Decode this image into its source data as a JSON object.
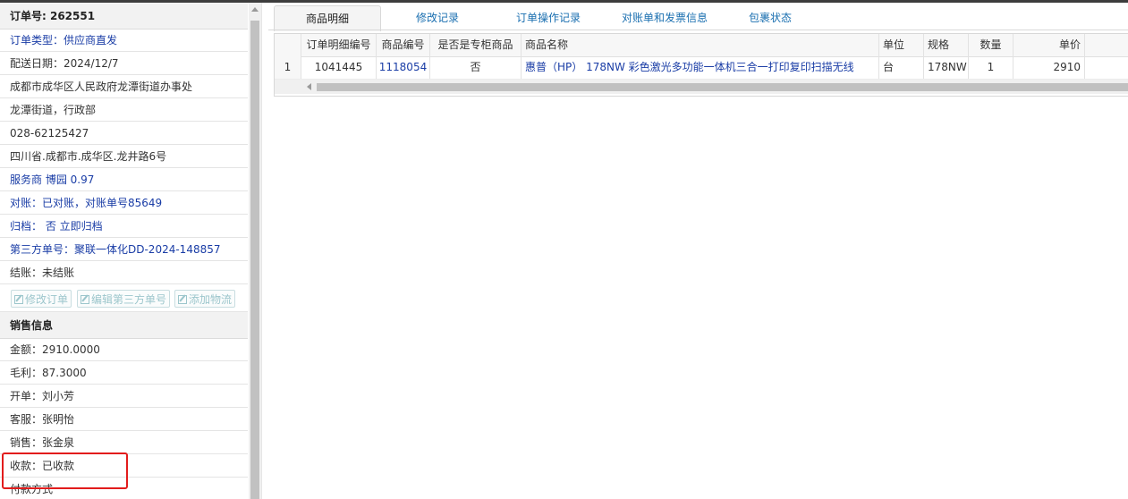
{
  "order": {
    "number_label": "订单号: 262551",
    "rows": [
      "订单类型：供应商直发",
      "配送日期：2024/12/7",
      "成都市成华区人民政府龙潭街道办事处",
      "龙潭街道，行政部",
      "028-62125427",
      "四川省.成都市.成华区.龙井路6号",
      "服务商 博园 0.97",
      "对账：已对账，对账单号85649",
      "归档： 否 立即归档",
      "第三方单号：聚联一体化DD-2024-148857",
      "结账：未结账"
    ],
    "buttons": [
      "修改订单",
      "编辑第三方单号",
      "添加物流"
    ]
  },
  "sales": {
    "header": "销售信息",
    "rows": [
      "金额：2910.0000",
      "毛利：87.3000",
      "开单：刘小芳",
      "客服：张明怡",
      "销售：张金泉",
      "收款：已收款",
      "付款方式"
    ]
  },
  "tabs": [
    "商品明细",
    "修改记录",
    "订单操作记录",
    "对账单和发票信息",
    "包裹状态"
  ],
  "table": {
    "columns": [
      "",
      "订单明细编号",
      "商品编号",
      "是否是专柜商品",
      "商品名称",
      "单位",
      "规格",
      "数量",
      "单价"
    ],
    "rows": [
      [
        "1",
        "1041445",
        "1118054",
        "否",
        "惠普（HP） 178NW 彩色激光多功能一体机三合一打印复印扫描无线",
        "台",
        "178NW",
        "1",
        "2910"
      ]
    ]
  },
  "colors": {
    "link": "#1a3da6",
    "tab_text": "#1a6fb0",
    "highlight_box": "#e21c1c"
  }
}
